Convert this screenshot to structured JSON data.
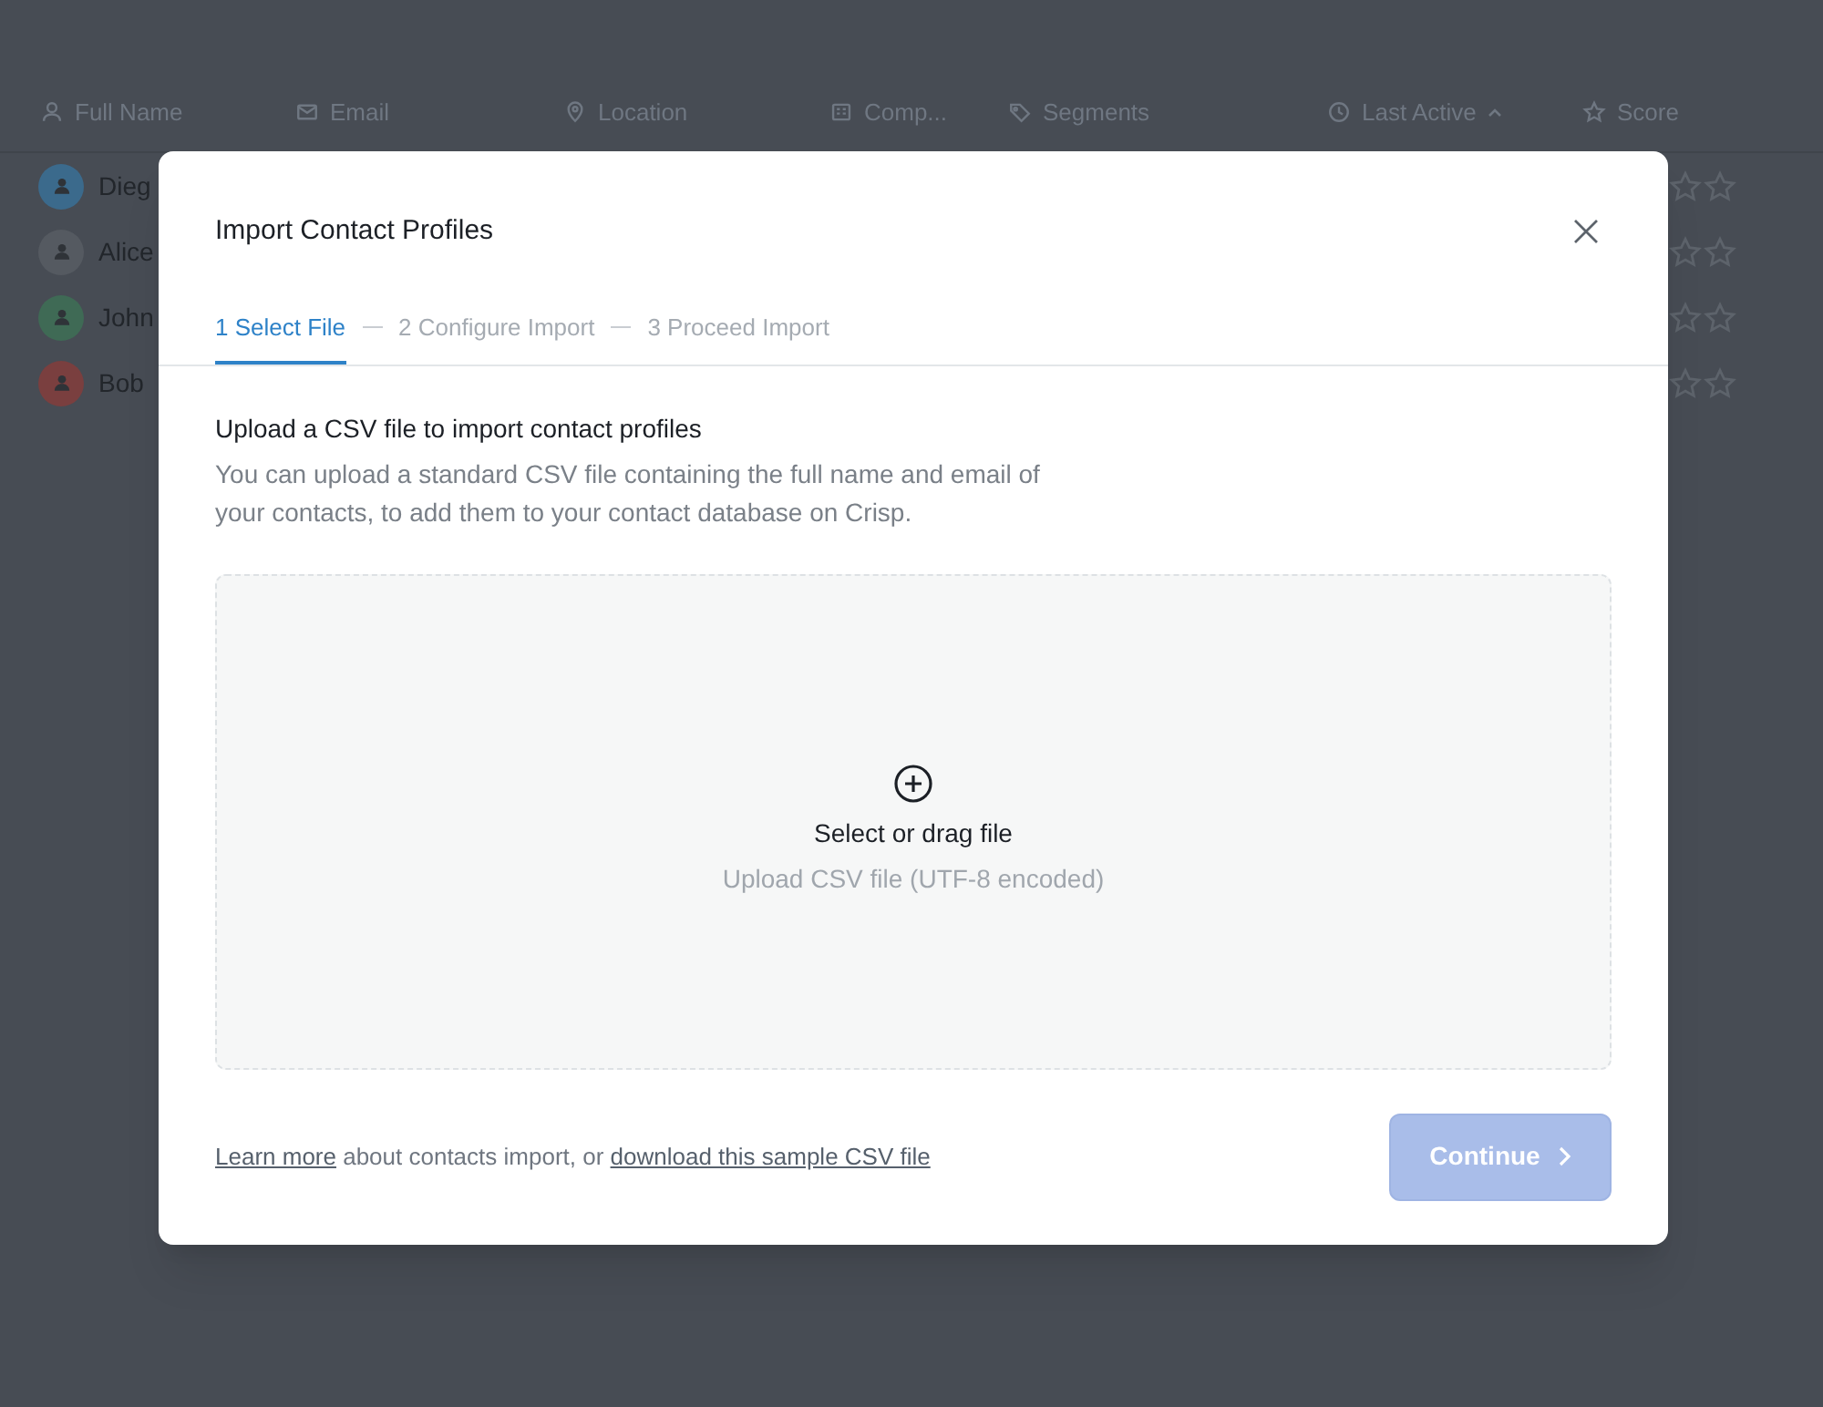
{
  "table": {
    "columns": [
      {
        "label": "Full Name",
        "sorted": false
      },
      {
        "label": "Email",
        "sorted": false
      },
      {
        "label": "Location",
        "sorted": false
      },
      {
        "label": "Comp...",
        "sorted": false
      },
      {
        "label": "Segments",
        "sorted": false
      },
      {
        "label": "Last Active",
        "sorted": true
      },
      {
        "label": "Score",
        "sorted": false
      }
    ],
    "rows": [
      {
        "name": "Dieg",
        "color": "#3b6a8c"
      },
      {
        "name": "Alice",
        "color": "#555a61"
      },
      {
        "name": "John",
        "color": "#3f6a55"
      },
      {
        "name": "Bob",
        "color": "#7a3f3f"
      }
    ]
  },
  "modal": {
    "title": "Import Contact Profiles",
    "steps": [
      {
        "label": "1 Select File",
        "selected": true
      },
      {
        "label": "2 Configure Import",
        "selected": false
      },
      {
        "label": "3 Proceed Import",
        "selected": false
      }
    ],
    "heading": "Upload a CSV file to import contact profiles",
    "description": "You can upload a standard CSV file containing the full name and email of your contacts, to add them to your contact database on Crisp.",
    "dropzone": {
      "title": "Select or drag file",
      "hint": "Upload CSV file (UTF-8 encoded)"
    },
    "footer": {
      "link1": "Learn more",
      "middle": "about contacts import, or",
      "link2": "download this sample CSV file"
    },
    "continue": {
      "label": "Continue",
      "disabled": true
    }
  }
}
